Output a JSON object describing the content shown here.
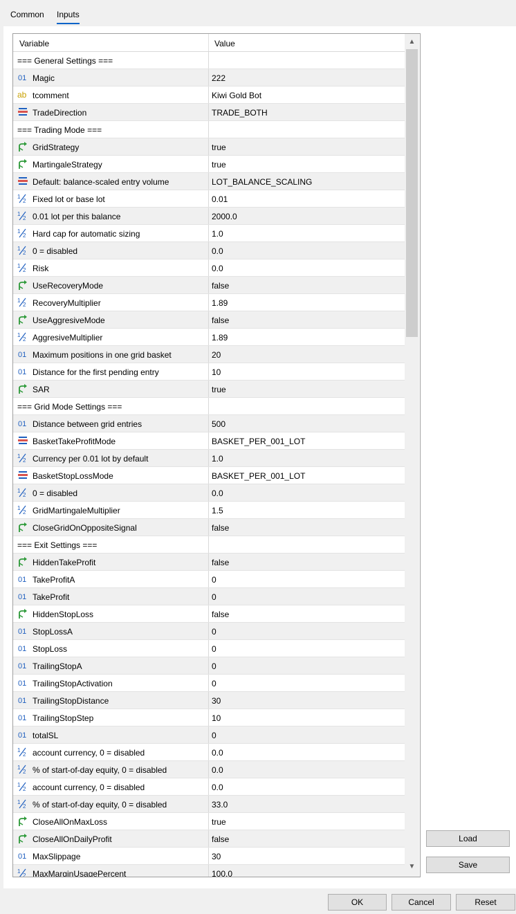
{
  "tabs": {
    "common": "Common",
    "inputs": "Inputs"
  },
  "header": {
    "variable": "Variable",
    "value": "Value"
  },
  "rows": [
    {
      "type": "section",
      "name": "=== General Settings ===",
      "value": ""
    },
    {
      "type": "int",
      "name": "Magic",
      "value": "222"
    },
    {
      "type": "string",
      "name": "tcomment",
      "value": "Kiwi Gold Bot"
    },
    {
      "type": "enum",
      "name": "TradeDirection",
      "value": "TRADE_BOTH"
    },
    {
      "type": "section",
      "name": "=== Trading Mode ===",
      "value": ""
    },
    {
      "type": "bool",
      "name": "GridStrategy",
      "value": "true"
    },
    {
      "type": "bool",
      "name": "MartingaleStrategy",
      "value": "true"
    },
    {
      "type": "enum",
      "name": "Default: balance-scaled entry volume",
      "value": "LOT_BALANCE_SCALING"
    },
    {
      "type": "double",
      "name": "Fixed lot or base lot",
      "value": "0.01"
    },
    {
      "type": "double",
      "name": "0.01 lot per this balance",
      "value": "2000.0"
    },
    {
      "type": "double",
      "name": "Hard cap for automatic sizing",
      "value": "1.0"
    },
    {
      "type": "double",
      "name": "0 = disabled",
      "value": "0.0"
    },
    {
      "type": "double",
      "name": "Risk",
      "value": "0.0"
    },
    {
      "type": "bool",
      "name": "UseRecoveryMode",
      "value": "false"
    },
    {
      "type": "double",
      "name": "RecoveryMultiplier",
      "value": "1.89"
    },
    {
      "type": "bool",
      "name": "UseAggresiveMode",
      "value": "false"
    },
    {
      "type": "double",
      "name": "AggresiveMultiplier",
      "value": "1.89"
    },
    {
      "type": "int",
      "name": "Maximum positions in one grid basket",
      "value": "20"
    },
    {
      "type": "int",
      "name": "Distance for the first pending entry",
      "value": "10"
    },
    {
      "type": "bool",
      "name": "SAR",
      "value": "true"
    },
    {
      "type": "section",
      "name": "=== Grid Mode Settings ===",
      "value": ""
    },
    {
      "type": "int",
      "name": "Distance between grid entries",
      "value": "500"
    },
    {
      "type": "enum",
      "name": "BasketTakeProfitMode",
      "value": "BASKET_PER_001_LOT"
    },
    {
      "type": "double",
      "name": "Currency per 0.01 lot by default",
      "value": "1.0"
    },
    {
      "type": "enum",
      "name": "BasketStopLossMode",
      "value": "BASKET_PER_001_LOT"
    },
    {
      "type": "double",
      "name": "0 = disabled",
      "value": "0.0"
    },
    {
      "type": "double",
      "name": "GridMartingaleMultiplier",
      "value": "1.5"
    },
    {
      "type": "bool",
      "name": "CloseGridOnOppositeSignal",
      "value": "false"
    },
    {
      "type": "section",
      "name": "=== Exit Settings ===",
      "value": ""
    },
    {
      "type": "bool",
      "name": "HiddenTakeProfit",
      "value": "false"
    },
    {
      "type": "int",
      "name": "TakeProfitA",
      "value": "0"
    },
    {
      "type": "int",
      "name": "TakeProfit",
      "value": "0"
    },
    {
      "type": "bool",
      "name": "HiddenStopLoss",
      "value": "false"
    },
    {
      "type": "int",
      "name": "StopLossA",
      "value": "0"
    },
    {
      "type": "int",
      "name": "StopLoss",
      "value": "0"
    },
    {
      "type": "int",
      "name": "TrailingStopA",
      "value": "0"
    },
    {
      "type": "int",
      "name": "TrailingStopActivation",
      "value": "0"
    },
    {
      "type": "int",
      "name": "TrailingStopDistance",
      "value": "30"
    },
    {
      "type": "int",
      "name": "TrailingStopStep",
      "value": "10"
    },
    {
      "type": "int",
      "name": "totalSL",
      "value": "0"
    },
    {
      "type": "double",
      "name": "account currency, 0 = disabled",
      "value": "0.0"
    },
    {
      "type": "double",
      "name": "% of start-of-day equity, 0 = disabled",
      "value": "0.0"
    },
    {
      "type": "double",
      "name": "account currency, 0 = disabled",
      "value": "0.0"
    },
    {
      "type": "double",
      "name": "% of start-of-day equity, 0 = disabled",
      "value": "33.0"
    },
    {
      "type": "bool",
      "name": "CloseAllOnMaxLoss",
      "value": "true"
    },
    {
      "type": "bool",
      "name": "CloseAllOnDailyProfit",
      "value": "false"
    },
    {
      "type": "int",
      "name": "MaxSlippage",
      "value": "30"
    },
    {
      "type": "double",
      "name": "MaxMarginUsagePercent",
      "value": "100.0"
    }
  ],
  "buttons": {
    "load": "Load",
    "save": "Save",
    "ok": "OK",
    "cancel": "Cancel",
    "reset": "Reset"
  },
  "icons": {
    "int": "int-type-icon",
    "string": "string-type-icon",
    "enum": "enum-type-icon",
    "double": "double-type-icon",
    "bool": "bool-type-icon"
  },
  "colors": {
    "accent": "#0a64c8",
    "bool_icon": "#2e9a3a",
    "string_icon": "#c8a000",
    "enum_icon": "#1f5fbf"
  }
}
